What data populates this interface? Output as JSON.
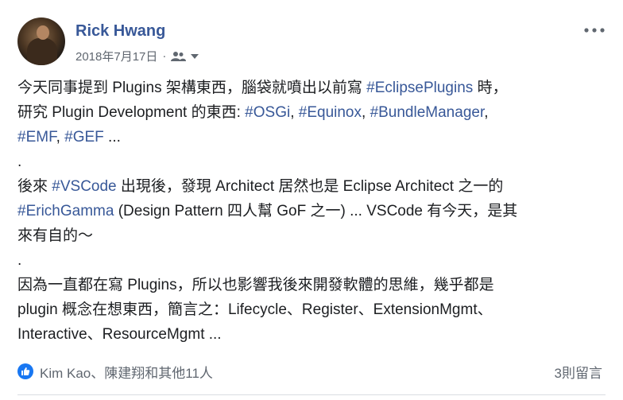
{
  "post": {
    "author": "Rick Hwang",
    "date": "2018年7月17日",
    "separator": "·",
    "audience_icon": "friends-icon",
    "content": {
      "p1": {
        "t1": "今天同事提到 Plugins 架構東西，腦袋就噴出以前寫 ",
        "tag1": "#EclipsePlugins",
        "t2": " 時，"
      },
      "p2": {
        "t1": "研究 Plugin Development 的東西: ",
        "tag1": "#OSGi",
        "t2": ", ",
        "tag2": "#Equinox",
        "t3": ", ",
        "tag3": "#BundleManager",
        "t4": ","
      },
      "p3": {
        "tag1": "#EMF",
        "t1": ", ",
        "tag2": "#GEF",
        "t2": " ..."
      },
      "p4": ".",
      "p5": {
        "t1": "後來 ",
        "tag1": "#VSCode",
        "t2": " 出現後，發現 Architect 居然也是 Eclipse Architect 之一的"
      },
      "p6": {
        "tag1": "#ErichGamma",
        "t1": " (Design Pattern 四人幫 GoF 之一) ... VSCode 有今天，是其"
      },
      "p7": "來有自的～",
      "p8": ".",
      "p9": "因為一直都在寫 Plugins，所以也影響我後來開發軟體的思維，幾乎都是",
      "p10": "plugin 概念在想東西，簡言之：Lifecycle、Register、ExtensionMgmt、",
      "p11": "Interactive、ResourceMgmt ..."
    },
    "reactions": "Kim Kao、陳建翔和其他11人",
    "comments": "3則留言"
  },
  "colors": {
    "link": "#385898",
    "like": "#1877f2",
    "meta": "#606770"
  }
}
